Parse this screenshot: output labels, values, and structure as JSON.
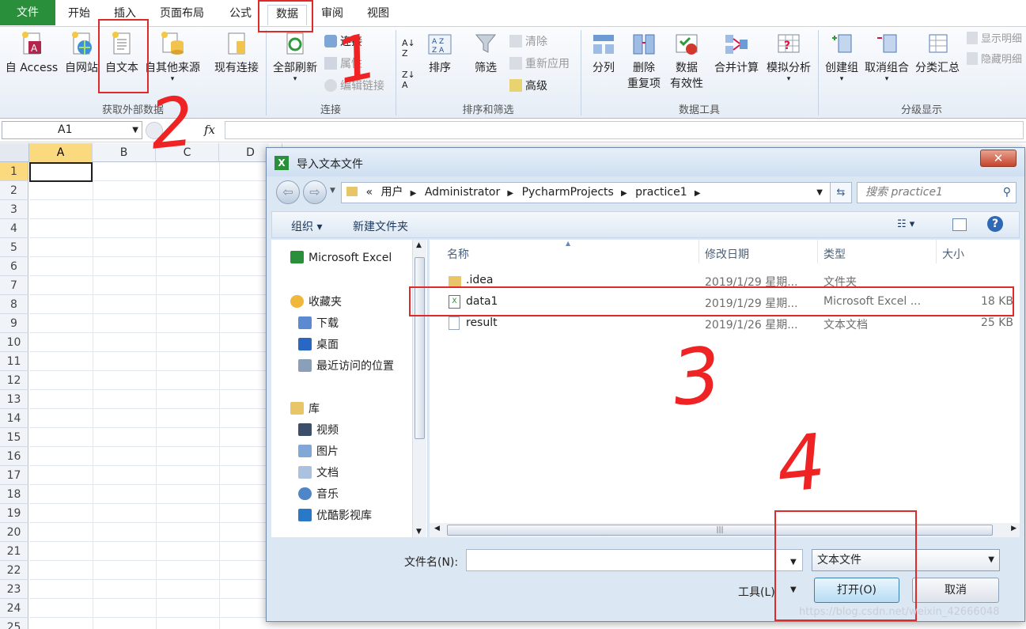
{
  "ribbon": {
    "tabs": [
      "文件",
      "开始",
      "插入",
      "页面布局",
      "公式",
      "数据",
      "审阅",
      "视图"
    ],
    "groups": {
      "external": {
        "label": "获取外部数据",
        "buttons": [
          "自 Access",
          "自网站",
          "自文本",
          "自其他来源",
          "现有连接"
        ]
      },
      "connections": {
        "label": "连接",
        "refresh_all": "全部刷新",
        "items": [
          "连接",
          "属性",
          "编辑链接"
        ]
      },
      "sort_filter": {
        "label": "排序和筛选",
        "sort": "排序",
        "filter": "筛选",
        "items": [
          "清除",
          "重新应用",
          "高级"
        ]
      },
      "data_tools": {
        "label": "数据工具",
        "buttons": [
          "分列",
          "删除\n重复项",
          "数据\n有效性",
          "合并计算",
          "模拟分析"
        ],
        "b1": "分列",
        "b2a": "删除",
        "b2b": "重复项",
        "b3a": "数据",
        "b3b": "有效性",
        "b4": "合并计算",
        "b5": "模拟分析"
      },
      "outline": {
        "label": "分级显示",
        "buttons": [
          "创建组",
          "取消组合",
          "分类汇总"
        ],
        "items": [
          "显示明细",
          "隐藏明细"
        ]
      }
    }
  },
  "formula_bar": {
    "name_box": "A1",
    "fx": "fx"
  },
  "sheet": {
    "columns": [
      "A",
      "B",
      "C",
      "D"
    ],
    "rows": [
      "1",
      "2",
      "3",
      "4",
      "5",
      "6",
      "7",
      "8",
      "9",
      "10",
      "11",
      "12",
      "13",
      "14",
      "15",
      "16",
      "17",
      "18",
      "19",
      "20",
      "21",
      "22",
      "23",
      "24",
      "25"
    ]
  },
  "dialog": {
    "title": "导入文本文件",
    "close": "✕",
    "breadcrumb": [
      "«",
      "用户",
      "Administrator",
      "PycharmProjects",
      "practice1"
    ],
    "search_placeholder": "搜索 practice1",
    "toolbar": {
      "organize": "组织 ▾",
      "new_folder": "新建文件夹"
    },
    "nav": {
      "top": "Microsoft Excel",
      "favorites": "收藏夹",
      "fav_items": [
        "下载",
        "桌面",
        "最近访问的位置"
      ],
      "library": "库",
      "lib_items": [
        "视频",
        "图片",
        "文档",
        "音乐",
        "优酷影视库"
      ]
    },
    "columns": [
      "名称",
      "修改日期",
      "类型",
      "大小"
    ],
    "files": [
      {
        "name": ".idea",
        "date": "2019/1/29 星期...",
        "type": "文件夹",
        "size": ""
      },
      {
        "name": "data1",
        "date": "2019/1/29 星期...",
        "type": "Microsoft Excel ...",
        "size": "18 KB"
      },
      {
        "name": "result",
        "date": "2019/1/26 星期...",
        "type": "文本文档",
        "size": "25 KB"
      }
    ],
    "filename_label": "文件名(N):",
    "filename_value": "",
    "filetype": "文本文件",
    "tools_label": "工具(L)",
    "open_button": "打开(O)",
    "cancel_button": "取消"
  },
  "annotations": [
    "1",
    "2",
    "3",
    "4"
  ],
  "watermark": "https://blog.csdn.net/weixin_42666048",
  "colors": {
    "file_tab": "#2a8f3a",
    "annotation": "#e02a2a",
    "selected_header": "#fbd97f"
  }
}
